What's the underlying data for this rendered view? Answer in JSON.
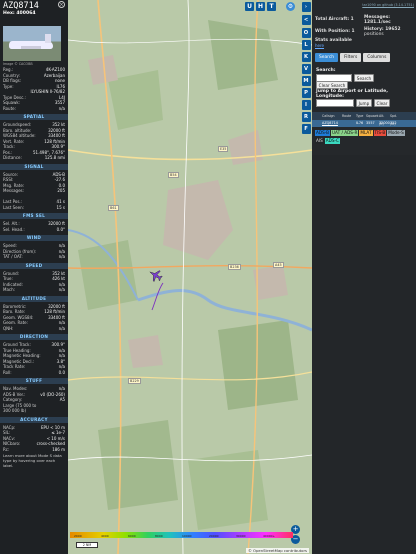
{
  "aircraft": {
    "callsign": "AZQ8714",
    "hex_line": "Hex: 400064",
    "photo_credit": "Image © CACOBB"
  },
  "details": [
    {
      "k": "Reg.:",
      "v": "4K-AZ100"
    },
    {
      "k": "Country:",
      "v": "Azerbaijan"
    },
    {
      "k": "DB flags:",
      "v": "none"
    },
    {
      "k": "Type:",
      "v": "IL76"
    },
    {
      "k": "",
      "v": "ILYUSHIN Il-76/82"
    },
    {
      "k": "Type Desc.:",
      "v": "L4J"
    },
    {
      "k": "Squawk:",
      "v": "3557"
    },
    {
      "k": "Route:",
      "v": "n/a"
    }
  ],
  "sections": {
    "spatial": {
      "title": "SPATIAL",
      "rows": [
        {
          "k": "Groundspeed:",
          "v": "352 kt"
        },
        {
          "k": "Baro. altitude:",
          "v": "32000 ft"
        },
        {
          "k": "WGS84 altitude:",
          "v": "33400 ft"
        },
        {
          "k": "Vert. Rate:",
          "v": "128 ft/min"
        },
        {
          "k": "Track:",
          "v": "300.9°"
        },
        {
          "k": "Pos.:",
          "v": "51.498°, 7.676°"
        },
        {
          "k": "Distance:",
          "v": "125.8 nmi"
        }
      ]
    },
    "signal": {
      "title": "SIGNAL",
      "rows": [
        {
          "k": "Source:",
          "v": "ADS-B"
        },
        {
          "k": "RSSI:",
          "v": "-27.6"
        },
        {
          "k": "Msg. Rate:",
          "v": "0.0"
        },
        {
          "k": "Messages:",
          "v": "205"
        },
        {
          "k": "",
          "v": ""
        },
        {
          "k": "Last Pos.:",
          "v": "41 s"
        },
        {
          "k": "Last Seen:",
          "v": "15 s"
        }
      ]
    },
    "fmssel": {
      "title": "FMS SEL",
      "rows": [
        {
          "k": "Sel. Alt.:",
          "v": "32000 ft"
        },
        {
          "k": "Sel. Head.:",
          "v": "0.0°"
        }
      ]
    },
    "wind": {
      "title": "WIND",
      "rows": [
        {
          "k": "Speed:",
          "v": "n/a"
        },
        {
          "k": "Direction (from):",
          "v": "n/a"
        },
        {
          "k": "TAT / OAT:",
          "v": "n/a"
        }
      ]
    },
    "speed": {
      "title": "SPEED",
      "rows": [
        {
          "k": "Ground:",
          "v": "352 kt"
        },
        {
          "k": "True:",
          "v": "426 kt"
        },
        {
          "k": "Indicated:",
          "v": "n/a"
        },
        {
          "k": "Mach:",
          "v": "n/a"
        }
      ]
    },
    "altitude": {
      "title": "ALTITUDE",
      "rows": [
        {
          "k": "Barometric:",
          "v": "32000 ft"
        },
        {
          "k": "Baro. Rate:",
          "v": "128 ft/min"
        },
        {
          "k": "Geom. WGS84:",
          "v": "33400 ft"
        },
        {
          "k": "Geom. Rate:",
          "v": "n/a"
        },
        {
          "k": "QNH:",
          "v": "n/a"
        }
      ]
    },
    "direction": {
      "title": "DIRECTION",
      "rows": [
        {
          "k": "Ground Track:",
          "v": "300.9°"
        },
        {
          "k": "True Heading:",
          "v": "n/a"
        },
        {
          "k": "Magnetic Heading:",
          "v": "n/a"
        },
        {
          "k": "Magnetic Decl.:",
          "v": "3.8°"
        },
        {
          "k": "Track Rate:",
          "v": "n/a"
        },
        {
          "k": "Roll:",
          "v": "0.0"
        }
      ]
    },
    "stuff": {
      "title": "STUFF",
      "rows": [
        {
          "k": "Nav. Modes:",
          "v": "n/a"
        },
        {
          "k": "ADS-B Ver.:",
          "v": "v0 (DO-260)"
        },
        {
          "k": "Category:",
          "v": "A5"
        },
        {
          "k": "Large (75 000 to",
          "v": ""
        },
        {
          "k": "300 000 lb)",
          "v": ""
        }
      ]
    },
    "accuracy": {
      "title": "ACCURACY",
      "rows": [
        {
          "k": "NACp:",
          "v": "EPU < 10 m"
        },
        {
          "k": "SIL:",
          "v": "≤ 1e-7"
        },
        {
          "k": "NACv:",
          "v": "< 10 m/s"
        },
        {
          "k": "NICbaro:",
          "v": "cross-checked"
        },
        {
          "k": "Rc:",
          "v": "186 m"
        }
      ]
    }
  },
  "footer_note": "Learn more about Mode S data type by hovering over each label.",
  "map": {
    "buttons": [
      "U",
      "H",
      "T"
    ],
    "zoom_in": "+",
    "zoom_out": "−",
    "scale": "2 NM",
    "attribution": "© OpenStreetMap contributors",
    "legend_ticks": [
      "2000",
      "4000",
      "6000",
      "8000",
      "10000",
      "20000",
      "30000",
      "40000+"
    ],
    "town_labels": [
      "E35",
      "B54",
      "B61",
      "B236",
      "A45",
      "B229"
    ]
  },
  "strip_buttons": [
    "<",
    "O",
    "L",
    "K",
    "V",
    "M",
    "P",
    "I",
    "R",
    "F"
  ],
  "sidebar": {
    "version": "tar1090 on github (3.14.1751)",
    "total_aircraft": "Total Aircraft: 1",
    "with_position": "With Position: 1",
    "stats": "Stats available",
    "messages": "Messages:",
    "messages_rate": "1281.1/sec",
    "history": "History: 19652",
    "history2": "positions",
    "tabs": [
      "Search",
      "Filters",
      "Columns"
    ],
    "search_label": "Search:",
    "search_button": "Search",
    "clear_search": "Clear Search",
    "jump_label": "Jump to Airport or Latitude, Longitude:",
    "jump_button": "Jump",
    "clear_button": "Clear",
    "table": {
      "headers": [
        "",
        "Callsign",
        "Route",
        "Type",
        "Squawk",
        "Alt. (ft)",
        "Spd. (kt)"
      ],
      "rows": [
        [
          "",
          "AZQ8714",
          "",
          "IL76",
          "3557",
          "32000",
          "352"
        ]
      ]
    },
    "source_tags": [
      {
        "label": "ADS-B",
        "color": "#1e7bd6"
      },
      {
        "label": "UAT / ADS-R",
        "color": "#8ad38a"
      },
      {
        "label": "MLAT",
        "color": "#f5b041"
      },
      {
        "label": "TIS-B",
        "color": "#e74c3c"
      },
      {
        "label": "Mode-S",
        "color": "#9aa7b0"
      },
      {
        "label": "AIS",
        "color": "#232629"
      },
      {
        "label": "ADS-C",
        "color": "#3ad9c0"
      }
    ]
  }
}
